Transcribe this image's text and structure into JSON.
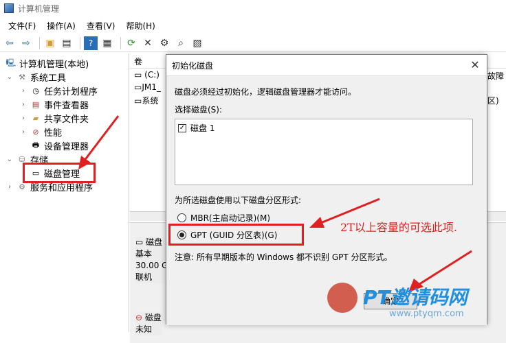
{
  "window": {
    "title": "计算机管理"
  },
  "menu": [
    "文件(F)",
    "操作(A)",
    "查看(V)",
    "帮助(H)"
  ],
  "toolbar": {
    "icons": [
      "back-icon",
      "forward-icon",
      "up-folder-icon",
      "properties-icon",
      "help-icon",
      "view-icon",
      "refresh-icon",
      "delete-icon",
      "settings-icon",
      "search-icon",
      "export-icon"
    ]
  },
  "tree": {
    "root": "计算机管理(本地)",
    "system_tools": "系统工具",
    "task_scheduler": "任务计划程序",
    "event_viewer": "事件查看器",
    "shared_folders": "共享文件夹",
    "performance": "性能",
    "device_manager": "设备管理器",
    "storage": "存储",
    "disk_management": "磁盘管理",
    "services_apps": "服务和应用程序"
  },
  "volumes": {
    "header_col1": "卷",
    "header_right": "故障",
    "rows": [
      "(C:)",
      "JM1_",
      "系统",
      "区)"
    ]
  },
  "lower_disks": [
    {
      "name": "磁盘",
      "type": "基本",
      "size": "30.00 G",
      "status": "联机"
    },
    {
      "name": "磁盘",
      "status": "未知"
    }
  ],
  "dialog": {
    "title": "初始化磁盘",
    "intro": "磁盘必须经过初始化，逻辑磁盘管理器才能访问。",
    "select_label": "选择磁盘(S):",
    "disk_item": "磁盘 1",
    "partition_label": "为所选磁盘使用以下磁盘分区形式:",
    "option_mbr": "MBR(主启动记录)(M)",
    "option_gpt": "GPT (GUID 分区表)(G)",
    "selected": "gpt",
    "note": "注意: 所有早期版本的 Windows 都不识别 GPT 分区形式。",
    "ok_label": "确定"
  },
  "annotation": "2T以上容量的可选此项.",
  "watermark": {
    "brand": "PT邀请码网",
    "url": "www.ptyqm.com"
  },
  "colors": {
    "highlight": "#e02020",
    "watermark": "#1f8fe0"
  }
}
